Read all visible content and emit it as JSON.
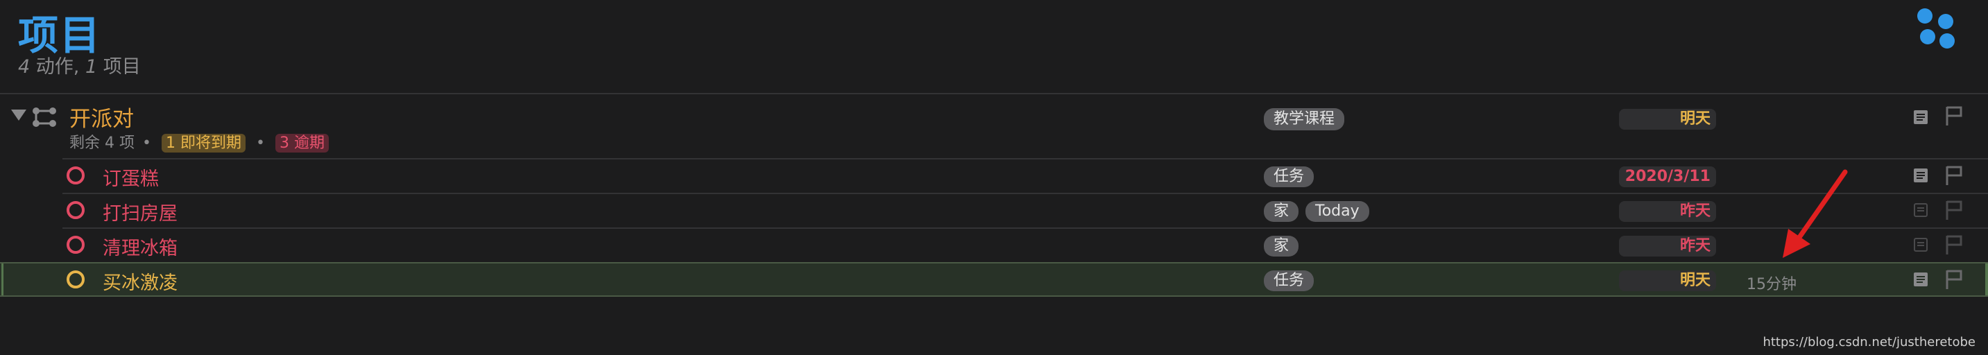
{
  "header": {
    "title": "项目",
    "summary_num1": "4",
    "summary_text1": " 动作, ",
    "summary_num2": "1",
    "summary_text2": " 项目"
  },
  "project": {
    "name": "开派对",
    "remaining": "剩余 4 项",
    "dot": "•",
    "due_soon_badge": "1 即将到期",
    "overdue_badge": "3 逾期",
    "tag": "教学课程",
    "date": "明天"
  },
  "actions": [
    {
      "name": "订蛋糕",
      "tags": [
        "任务"
      ],
      "date": "2020/3/11",
      "status": "overdue",
      "estimate": ""
    },
    {
      "name": "打扫房屋",
      "tags": [
        "家",
        "Today"
      ],
      "date": "昨天",
      "status": "overdue",
      "estimate": ""
    },
    {
      "name": "清理冰箱",
      "tags": [
        "家"
      ],
      "date": "昨天",
      "status": "overdue",
      "estimate": ""
    },
    {
      "name": "买冰激凌",
      "tags": [
        "任务"
      ],
      "date": "明天",
      "status": "due",
      "estimate": "15分钟"
    }
  ],
  "icons": {
    "perspective": "perspective-dots-icon",
    "disclosure": "disclosure-triangle-icon",
    "project": "project-icon",
    "note": "note-icon",
    "flag": "flag-icon"
  },
  "colors": {
    "accent_blue": "#3a9ce8",
    "project_orange": "#e8a33d",
    "overdue_red": "#e24a64",
    "due_yellow": "#e8b54a",
    "selection_green": "#283227"
  },
  "watermark": "https://blog.csdn.net/justheretobe"
}
